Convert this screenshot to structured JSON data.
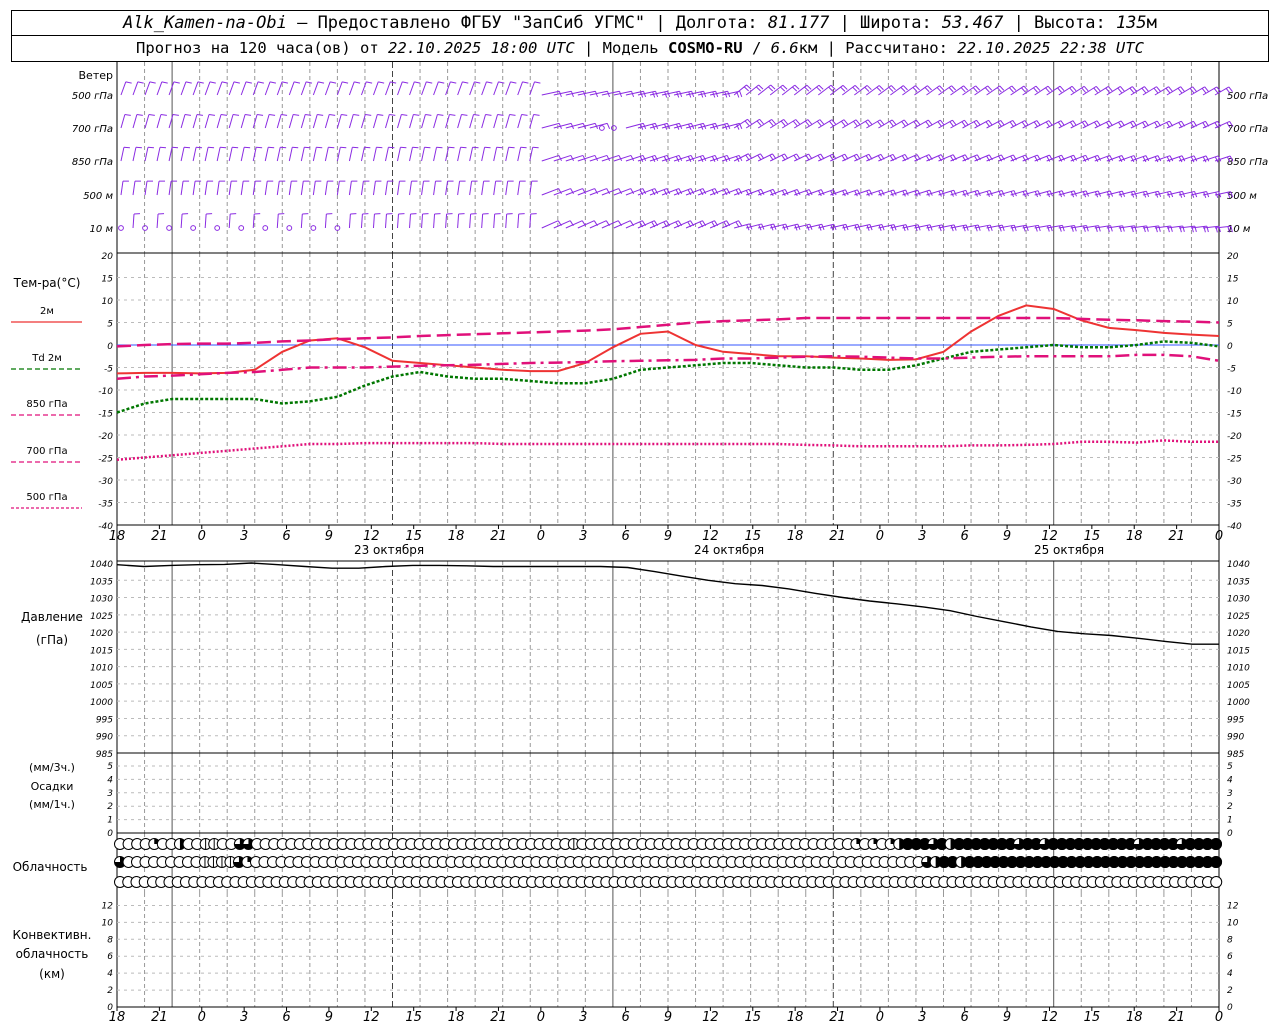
{
  "header": {
    "station": "Alk_Kamen-na-Obi",
    "dash": " – ",
    "provided_label": "Предоставлено ФГБУ \"ЗапСиб УГМС\"",
    "lon_label": " | Долгота: ",
    "lon_value": "81.177",
    "lat_label": " | Широта: ",
    "lat_value": "53.467",
    "alt_label": " | Высота: ",
    "alt_value": "135",
    "alt_unit": "м",
    "forecast_label": "Прогноз на 120 часа(ов) от ",
    "forecast_start": "22.10.2025 18:00 UTC",
    "model_label": "  | Модель ",
    "model_name": "COSMO-RU",
    "model_sep": " / ",
    "model_res": "6.6",
    "model_res_unit": "км",
    "calc_label": " | Рассчитано: ",
    "calc_time": "22.10.2025 22:38 UTC"
  },
  "time_axis": {
    "hour_labels": [
      "18",
      "21",
      "0",
      "3",
      "6",
      "9",
      "12",
      "15",
      "18",
      "21",
      "0",
      "3",
      "6",
      "9",
      "12",
      "15",
      "18",
      "21",
      "0",
      "3",
      "6",
      "9",
      "12",
      "15",
      "18",
      "21",
      "0"
    ],
    "day_labels": [
      "23 октября",
      "24 октября",
      "25 октября"
    ]
  },
  "wind_panel": {
    "title": "Ветер",
    "level_labels": [
      "500 гПа",
      "700 гПа",
      "850 гПа",
      "500 м",
      "10 м"
    ],
    "color": "#8a2be2"
  },
  "chart_data": [
    {
      "type": "line",
      "name": "temperature",
      "ylabel": "Тем-ра(°C)",
      "ylim": [
        -40,
        20
      ],
      "yticks": [
        20,
        15,
        10,
        5,
        0,
        -5,
        -10,
        -15,
        -20,
        -25,
        -30,
        -35,
        -40
      ],
      "x_hours": [
        0,
        3,
        6,
        9,
        12,
        15,
        18,
        21,
        24,
        27,
        30,
        33,
        36,
        39,
        42,
        45,
        48,
        51,
        54,
        57,
        60,
        63,
        66,
        69,
        72,
        75,
        78,
        81,
        84,
        87,
        90,
        93,
        96,
        99,
        102,
        105,
        108,
        111,
        114,
        117,
        120
      ],
      "series": [
        {
          "name": "2м",
          "color": "#ee3333",
          "style": "solid",
          "values": [
            -6.3,
            -6.2,
            -6.2,
            -6.3,
            -6.2,
            -5.5,
            -1.5,
            1,
            1.5,
            -0.5,
            -3.5,
            -4,
            -4.5,
            -5,
            -5.5,
            -5.8,
            -5.8,
            -4,
            -0.5,
            2.5,
            3,
            0,
            -1.5,
            -2,
            -2.5,
            -2.5,
            -2.8,
            -3,
            -3.3,
            -3.2,
            -1.5,
            3,
            6.5,
            8.8,
            8,
            5.5,
            3.8,
            3.3,
            2.7,
            2.3,
            2
          ]
        },
        {
          "name": "Td 2м",
          "color": "#007700",
          "style": "dotted",
          "values": [
            -15,
            -13,
            -12,
            -12,
            -12,
            -12,
            -13,
            -12.5,
            -11.5,
            -9,
            -7,
            -6,
            -7,
            -7.5,
            -7.5,
            -8,
            -8.5,
            -8.5,
            -7.5,
            -5.5,
            -5,
            -4.5,
            -4,
            -4,
            -4.5,
            -5,
            -5,
            -5.5,
            -5.5,
            -4.5,
            -3,
            -1.5,
            -1,
            -0.5,
            0,
            -0.5,
            -0.5,
            0,
            0.8,
            0.5,
            -0.3
          ]
        },
        {
          "name": "850 гПа",
          "color": "#e0107a",
          "style": "longdash",
          "values": [
            -0.3,
            0,
            0.2,
            0.3,
            0.3,
            0.5,
            0.8,
            1,
            1.3,
            1.5,
            1.7,
            2,
            2.2,
            2.4,
            2.6,
            2.8,
            3,
            3.2,
            3.5,
            4,
            4.5,
            5,
            5.3,
            5.5,
            5.7,
            6,
            6,
            6,
            6,
            6,
            6,
            6,
            6,
            6,
            6,
            5.8,
            5.6,
            5.5,
            5.3,
            5.2,
            5
          ]
        },
        {
          "name": "700 гПа",
          "color": "#e0107a",
          "style": "dashdot",
          "values": [
            -7.5,
            -7,
            -6.8,
            -6.5,
            -6.2,
            -6,
            -5.5,
            -5,
            -5,
            -5,
            -4.8,
            -4.6,
            -4.5,
            -4.4,
            -4.2,
            -4,
            -3.9,
            -3.8,
            -3.6,
            -3.5,
            -3.4,
            -3.3,
            -3,
            -3,
            -2.8,
            -2.6,
            -2.5,
            -2.6,
            -2.8,
            -3,
            -3,
            -2.8,
            -2.6,
            -2.5,
            -2.5,
            -2.5,
            -2.5,
            -2.2,
            -2.2,
            -2.5,
            -3.5
          ]
        },
        {
          "name": "500 гПа",
          "color": "#e0107a",
          "style": "dotted",
          "values": [
            -25.5,
            -25,
            -24.5,
            -24,
            -23.5,
            -23,
            -22.5,
            -22,
            -22,
            -21.8,
            -21.8,
            -21.8,
            -21.8,
            -21.8,
            -22,
            -22,
            -22,
            -22,
            -22,
            -22,
            -22,
            -22,
            -22,
            -22,
            -22,
            -22.2,
            -22.3,
            -22.5,
            -22.5,
            -22.5,
            -22.5,
            -22.3,
            -22.3,
            -22.2,
            -22,
            -21.5,
            -21.5,
            -21.7,
            -21.2,
            -21.5,
            -21.5
          ]
        }
      ]
    },
    {
      "type": "line",
      "name": "pressure",
      "ylabel": "Давление",
      "yunit": "(гПа)",
      "ylim": [
        985,
        1040
      ],
      "yticks": [
        1040,
        1035,
        1030,
        1025,
        1020,
        1015,
        1010,
        1005,
        1000,
        995,
        990,
        985
      ],
      "series": [
        {
          "name": "Давление",
          "color": "#000000",
          "values": [
            1039.5,
            1039,
            1039.3,
            1039.5,
            1039.6,
            1040,
            1039.5,
            1039,
            1038.5,
            1038.5,
            1039,
            1039.3,
            1039.3,
            1039.2,
            1039,
            1039,
            1039,
            1039,
            1039,
            1038.7,
            1037.5,
            1036.2,
            1035,
            1034,
            1033.5,
            1032.5,
            1031.2,
            1030,
            1029,
            1028.2,
            1027.3,
            1026.2,
            1024.5,
            1023,
            1021.5,
            1020.2,
            1019.5,
            1019,
            1018.2,
            1017.3,
            1016.5,
            1016.5
          ]
        }
      ]
    },
    {
      "type": "bar",
      "name": "precipitation",
      "ylabel": "Осадки",
      "units": [
        "(мм/3ч.)",
        "(мм/1ч.)"
      ],
      "ylim": [
        0,
        5
      ],
      "yticks": [
        5,
        4,
        3,
        2,
        1,
        0
      ],
      "values": []
    },
    {
      "type": "heatmap",
      "name": "cloudiness",
      "ylabel": "Облачность",
      "cell_hours": 3,
      "legend": "0 clear, 1 quarter, 2 half, 3 three-quarter, 4 overcast, 5 dashed",
      "rows": [
        [
          0,
          0,
          0,
          0,
          1,
          0,
          0,
          2,
          0,
          0,
          5,
          5,
          0,
          0,
          3,
          3,
          0,
          0,
          0,
          0,
          0,
          0,
          0,
          0,
          0,
          0,
          0,
          0,
          0,
          0,
          0,
          0,
          0,
          0,
          0,
          0,
          0,
          0,
          0,
          0,
          0,
          0,
          0,
          0,
          0,
          0,
          0,
          0,
          0,
          0,
          0,
          0,
          0,
          5,
          0,
          0,
          0,
          0,
          0,
          0,
          0,
          0,
          0,
          0,
          0,
          0,
          0,
          0,
          0,
          0,
          0,
          0,
          0,
          0,
          0,
          0,
          0,
          0,
          0,
          0,
          0,
          0,
          0,
          0,
          0,
          0,
          1,
          0,
          1,
          0,
          1,
          2,
          4,
          4,
          4,
          3,
          4,
          2,
          4,
          4,
          4,
          4,
          4,
          4,
          4,
          3,
          4,
          4,
          3,
          4,
          4,
          4,
          4,
          4,
          4,
          4,
          4,
          4,
          4,
          3,
          4,
          4,
          4,
          4,
          3,
          4,
          4,
          4,
          4
        ],
        [
          3,
          0,
          0,
          0,
          0,
          0,
          0,
          0,
          0,
          0,
          5,
          5,
          5,
          5,
          3,
          1,
          0,
          0,
          0,
          0,
          0,
          0,
          0,
          0,
          0,
          0,
          0,
          0,
          0,
          0,
          0,
          0,
          0,
          0,
          0,
          0,
          0,
          0,
          0,
          0,
          0,
          0,
          0,
          0,
          0,
          0,
          0,
          0,
          0,
          0,
          0,
          0,
          0,
          0,
          0,
          0,
          0,
          0,
          0,
          0,
          0,
          0,
          0,
          0,
          0,
          0,
          0,
          0,
          0,
          0,
          0,
          0,
          0,
          0,
          0,
          0,
          0,
          0,
          0,
          0,
          0,
          0,
          0,
          0,
          0,
          0,
          0,
          0,
          0,
          0,
          0,
          0,
          0,
          0,
          0,
          3,
          2,
          4,
          4,
          2,
          4,
          4,
          4,
          4,
          4,
          4,
          4,
          4,
          4,
          4,
          4,
          4,
          4,
          4,
          4,
          4,
          4,
          4,
          4,
          4,
          4,
          4,
          4,
          4,
          4,
          4,
          4,
          4,
          4,
          4
        ],
        [
          0,
          0,
          0,
          0,
          0,
          0,
          0,
          0,
          0,
          0,
          0,
          0,
          0,
          0,
          0,
          0,
          0,
          0,
          0,
          0,
          0,
          0,
          0,
          0,
          0,
          0,
          0,
          0,
          0,
          0,
          0,
          0,
          0,
          0,
          0,
          0,
          0,
          0,
          0,
          0,
          0,
          0,
          0,
          0,
          0,
          0,
          0,
          0,
          0,
          0,
          0,
          0,
          0,
          0,
          0,
          0,
          0,
          0,
          0,
          0,
          0,
          0,
          0,
          0,
          0,
          0,
          0,
          0,
          0,
          0,
          0,
          0,
          0,
          0,
          0,
          0,
          0,
          0,
          0,
          0,
          0,
          0,
          0,
          0,
          0,
          0,
          0,
          0,
          0,
          0,
          0,
          0,
          0,
          0,
          0,
          0,
          0,
          0,
          0,
          0,
          0,
          0,
          0,
          0,
          0,
          0,
          0,
          0,
          0,
          0,
          0,
          0,
          0,
          0,
          0,
          0,
          0,
          0,
          0,
          0,
          0,
          0,
          0,
          0,
          0,
          0,
          0,
          0,
          0,
          0,
          0,
          0,
          0,
          0
        ]
      ]
    },
    {
      "type": "bar",
      "name": "convective_cloud",
      "ylabel": "Конвективн.",
      "ylabel2": "облачность",
      "yunit": "(км)",
      "ylim": [
        0,
        13
      ],
      "yticks": [
        12,
        10,
        8,
        6,
        4,
        2,
        0
      ],
      "values": []
    }
  ]
}
